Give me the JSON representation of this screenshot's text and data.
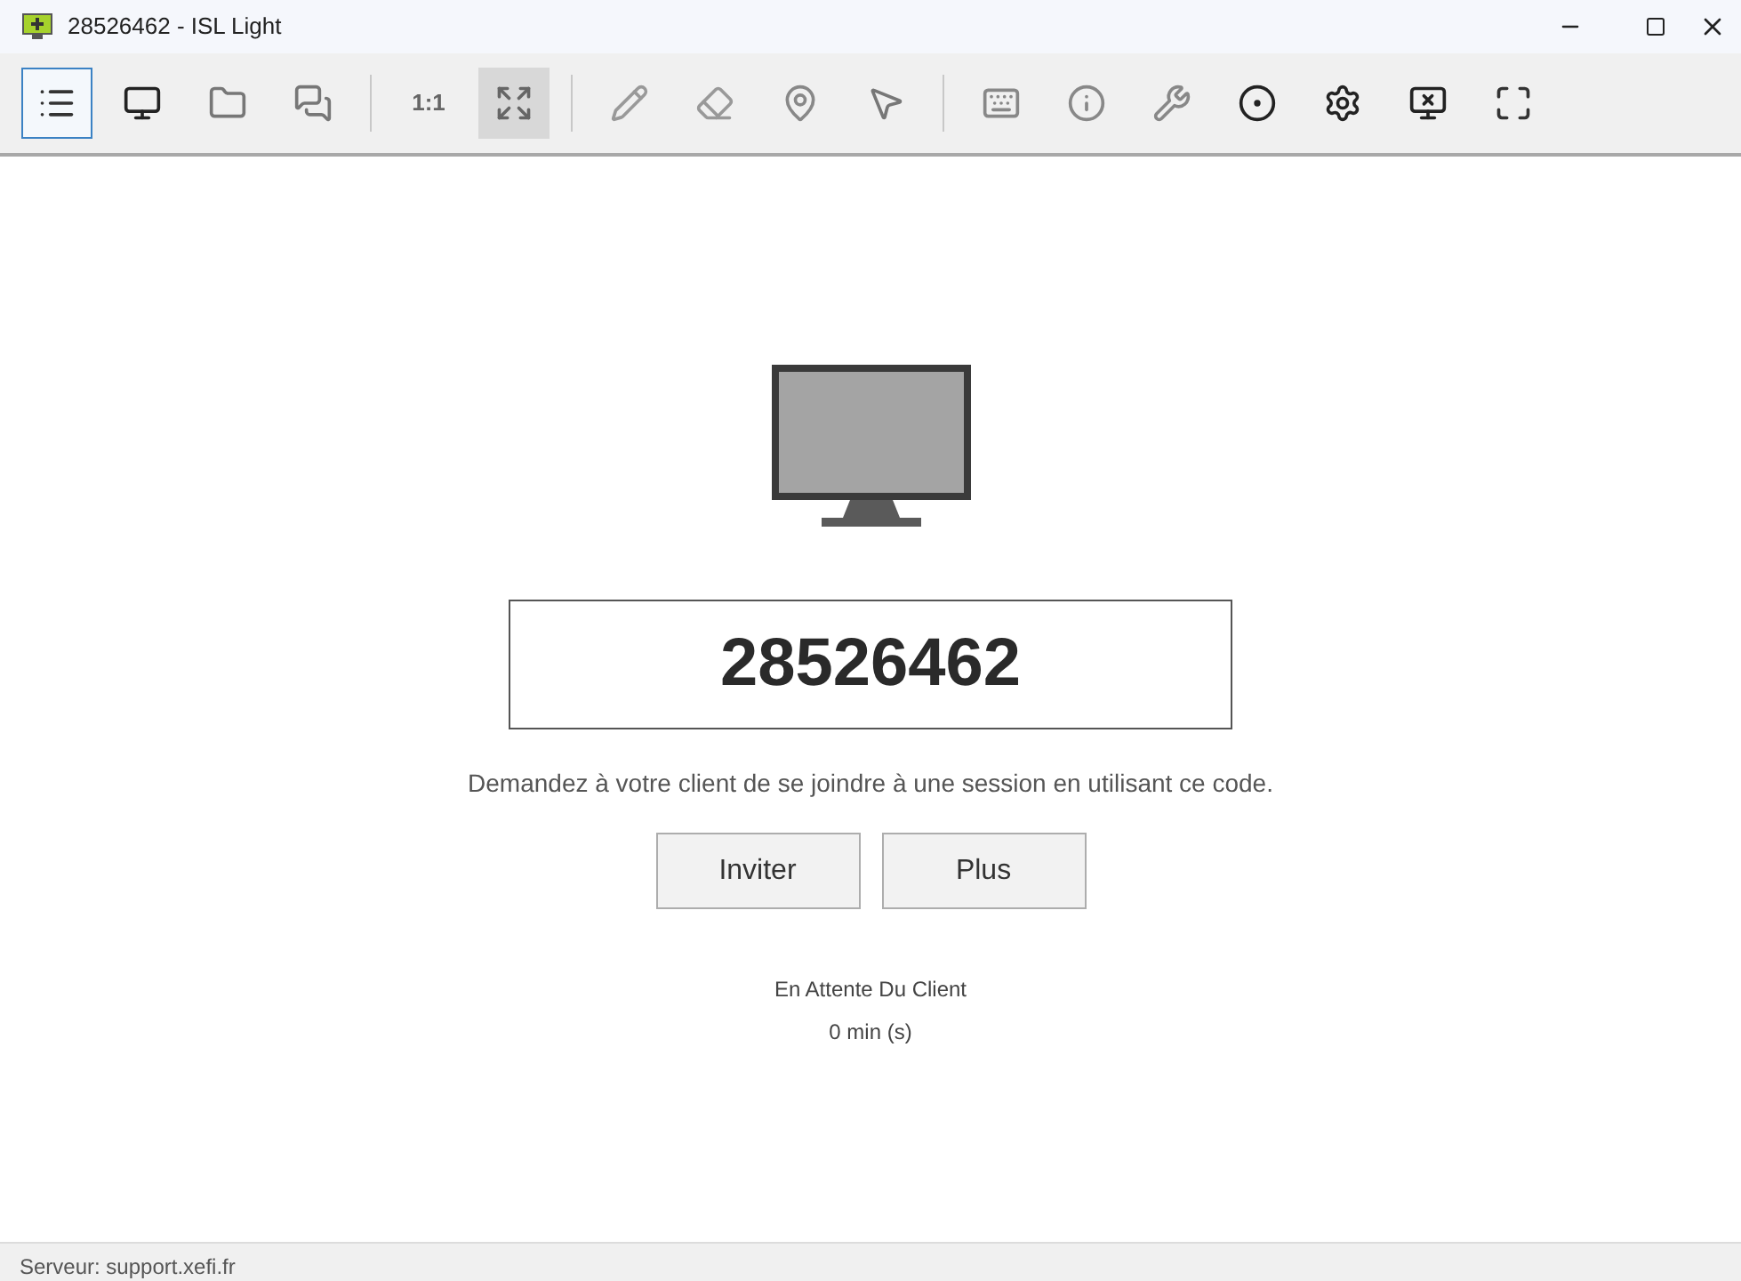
{
  "window": {
    "title": "28526462 - ISL Light"
  },
  "toolbar": [
    {
      "kind": "list",
      "selected": true
    },
    {
      "kind": "monitor",
      "selected": false
    },
    {
      "kind": "folder",
      "selected": false
    },
    {
      "kind": "chat",
      "selected": false
    },
    {
      "kind": "separator"
    },
    {
      "kind": "text",
      "label": "1:1",
      "selected": false
    },
    {
      "kind": "fit",
      "selected": true
    },
    {
      "kind": "separator"
    },
    {
      "kind": "pencil",
      "selected": false
    },
    {
      "kind": "eraser",
      "selected": false
    },
    {
      "kind": "pin",
      "selected": false
    },
    {
      "kind": "pointer",
      "selected": false
    },
    {
      "kind": "separator"
    },
    {
      "kind": "keyboard",
      "selected": false
    },
    {
      "kind": "info",
      "selected": false
    },
    {
      "kind": "tools",
      "selected": false
    },
    {
      "kind": "record",
      "selected": false
    },
    {
      "kind": "gear",
      "selected": false
    },
    {
      "kind": "disconnect",
      "selected": false
    },
    {
      "kind": "fullscreen",
      "selected": false
    }
  ],
  "session": {
    "code": "28526462",
    "instruction": "Demandez à votre client de se joindre à une session en utilisant ce code.",
    "buttons": [
      "Inviter",
      "Plus"
    ],
    "status": "En Attente Du Client",
    "elapsed": "0 min (s)"
  },
  "status_bar": "Serveur: support.xefi.fr"
}
